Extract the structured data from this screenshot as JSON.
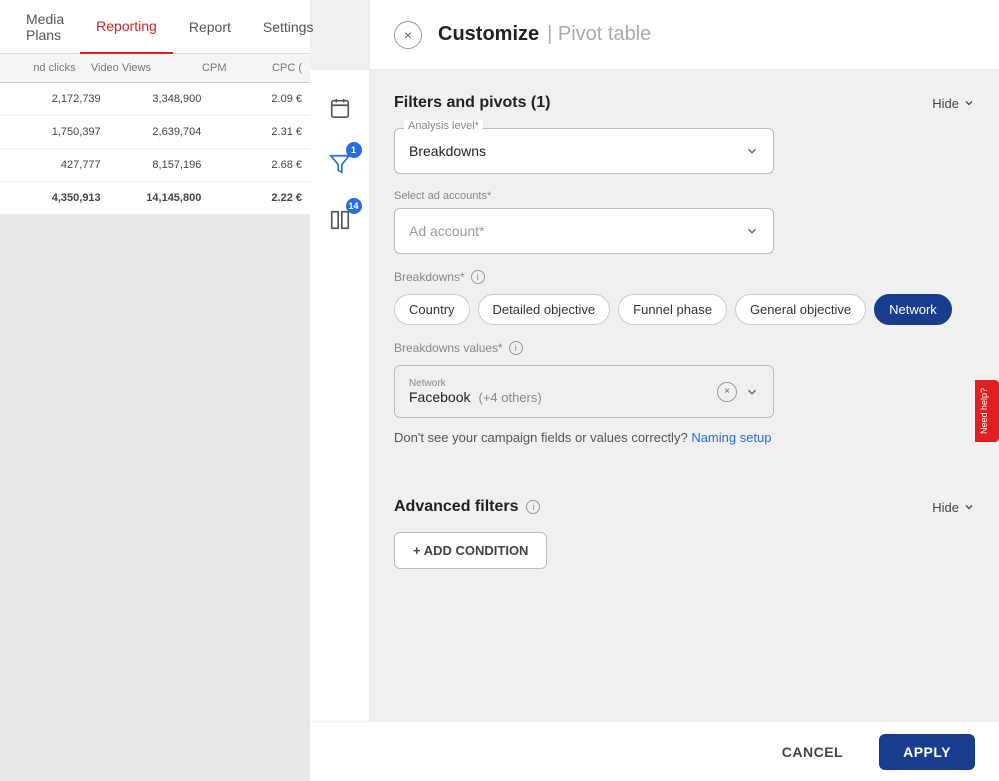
{
  "nav": {
    "items": [
      {
        "label": "Media Plans",
        "active": false
      },
      {
        "label": "Reporting",
        "active": true
      },
      {
        "label": "Report",
        "active": false
      },
      {
        "label": "Settings",
        "active": false
      }
    ]
  },
  "table": {
    "columns": [
      "nd clicks",
      "Video Views",
      "CPM",
      "CPC ("
    ],
    "rows": [
      {
        "cols": [
          "2,172,739",
          "3,348,900",
          "2.09 €"
        ],
        "bold": false
      },
      {
        "cols": [
          "1,750,397",
          "2,639,704",
          "2.31 €"
        ],
        "bold": false
      },
      {
        "cols": [
          "427,777",
          "8,157,196",
          "2.68 €"
        ],
        "bold": false
      },
      {
        "cols": [
          "4,350,913",
          "14,145,800",
          "2.22 €"
        ],
        "bold": true
      }
    ]
  },
  "modal": {
    "title": "Customize",
    "subtitle": "| Pivot table",
    "close_label": "×",
    "sections": {
      "filters": {
        "title": "Filters and pivots (1)",
        "hide_label": "Hide",
        "analysis_level_label": "Analysis level*",
        "analysis_level_value": "Breakdowns",
        "ad_accounts_label": "Select ad accounts*",
        "ad_account_placeholder": "Ad account*",
        "breakdowns_label": "Breakdowns*",
        "breakdowns_chips": [
          {
            "label": "Country",
            "selected": false
          },
          {
            "label": "Detailed objective",
            "selected": false
          },
          {
            "label": "Funnel phase",
            "selected": false
          },
          {
            "label": "General objective",
            "selected": false
          },
          {
            "label": "Network",
            "selected": true
          }
        ],
        "breakdowns_values_label": "Breakdowns values*",
        "network_label": "Network",
        "network_value": "Facebook",
        "network_others": "(+4 others)",
        "naming_text": "Don't see your campaign fields or values correctly?",
        "naming_link": "Naming setup"
      },
      "advanced": {
        "title": "Advanced filters",
        "hide_label": "Hide",
        "add_condition_label": "+ ADD CONDITION"
      }
    },
    "footer": {
      "cancel_label": "CANCEL",
      "apply_label": "APPLY"
    }
  },
  "sidebar_icons": [
    {
      "name": "calendar-icon",
      "badge": null
    },
    {
      "name": "filter-icon",
      "badge": "1"
    },
    {
      "name": "columns-icon",
      "badge": "14"
    }
  ],
  "feedback": {
    "label": "Need help?"
  }
}
